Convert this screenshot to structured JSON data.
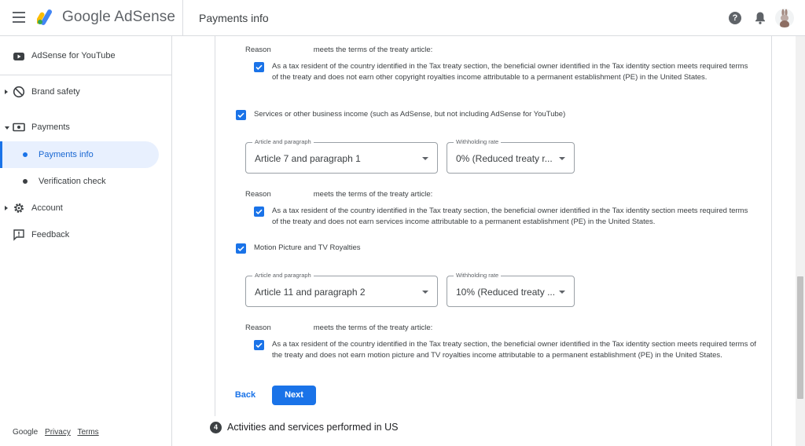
{
  "header": {
    "brand": "Google AdSense",
    "page_title": "Payments info",
    "help_glyph": "?"
  },
  "sidebar": {
    "items": [
      {
        "label": "AdSense for YouTube",
        "icon": "youtube-icon"
      },
      {
        "label": "Brand safety",
        "icon": "block-icon"
      },
      {
        "label": "Payments",
        "icon": "payments-icon"
      },
      {
        "label": "Payments info",
        "icon": "dot-icon"
      },
      {
        "label": "Verification check",
        "icon": "dot-icon"
      },
      {
        "label": "Account",
        "icon": "gear-icon"
      },
      {
        "label": "Feedback",
        "icon": "feedback-icon"
      }
    ],
    "footer": {
      "google": "Google",
      "privacy": "Privacy",
      "terms": "Terms"
    }
  },
  "main": {
    "reason_label": "Reason",
    "reason_suffix": "meets the terms of the treaty article:",
    "sections": [
      {
        "statement": "As a tax resident of the country identified in the Tax treaty section, the beneficial owner identified in the Tax identity section meets required terms of the treaty and does not earn other copyright royalties income attributable to a permanent establishment (PE) in the United States."
      },
      {
        "category": "Services or other business income (such as AdSense, but not including AdSense for YouTube)",
        "article_label": "Article and paragraph",
        "article_value": "Article 7 and paragraph 1",
        "rate_label": "Withholding rate",
        "rate_value": "0% (Reduced treaty r...",
        "statement": "As a tax resident of the country identified in the Tax treaty section, the beneficial owner identified in the Tax identity section meets required terms of the treaty and does not earn services income attributable to a permanent establishment (PE) in the United States."
      },
      {
        "category": "Motion Picture and TV Royalties",
        "article_label": "Article and paragraph",
        "article_value": "Article 11 and paragraph 2",
        "rate_label": "Withholding rate",
        "rate_value": "10% (Reduced treaty ...",
        "statement": "As a tax resident of the country identified in the Tax treaty section, the beneficial owner identified in the Tax identity section meets required terms of the treaty and does not earn motion picture and TV royalties income attributable to a permanent establishment (PE) in the United States."
      }
    ],
    "back_label": "Back",
    "next_label": "Next",
    "next_step_number": "4",
    "next_step_title": "Activities and services performed in US"
  },
  "colors": {
    "accent": "#1a73e8",
    "active_bg": "#e8f0fe"
  }
}
